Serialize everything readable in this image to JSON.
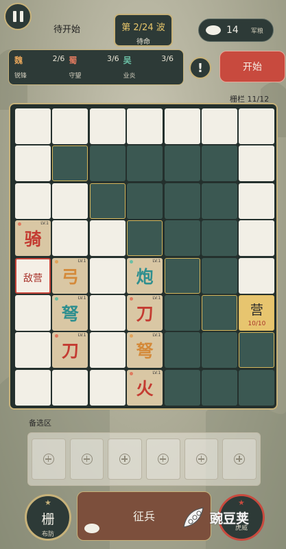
{
  "header": {
    "status": "待开始",
    "wave": {
      "title": "第 2/24 波",
      "subtitle": "待命"
    },
    "grain": {
      "count": "14",
      "label": "军粮"
    }
  },
  "factions": [
    {
      "name": "魏",
      "count": "2/6",
      "trait": "锐锋",
      "color": "#e2a35a"
    },
    {
      "name": "蜀",
      "count": "3/6",
      "trait": "守望",
      "color": "#e07a5f"
    },
    {
      "name": "吴",
      "count": "3/6",
      "trait": "业炎",
      "color": "#6bbfa5"
    }
  ],
  "alert_icon": "!",
  "start_label": "开始",
  "fence_count": "栅栏 11/12",
  "board": {
    "enemy_label": "敌营",
    "camp": {
      "char": "营",
      "hp": "10/10"
    },
    "units": [
      {
        "char": "骑",
        "lv": "LV.1",
        "color": "#c43c32"
      },
      {
        "char": "弓",
        "lv": "LV.1",
        "color": "#d48a3a"
      },
      {
        "char": "炮",
        "lv": "LV.1",
        "color": "#2f8f8f"
      },
      {
        "char": "弩",
        "lv": "LV.1",
        "color": "#2f8f8f"
      },
      {
        "char": "刀",
        "lv": "LV.1",
        "color": "#c43c32"
      },
      {
        "char": "刀",
        "lv": "LV.1",
        "color": "#c43c32"
      },
      {
        "char": "弩",
        "lv": "LV.1",
        "color": "#d48a3a"
      },
      {
        "char": "火",
        "lv": "LV.1",
        "color": "#c43c32"
      }
    ]
  },
  "bench": {
    "label": "备选区",
    "slots": 6
  },
  "bottom": {
    "fence_char": "栅",
    "fence_sub": "布防",
    "recruit_label": "征兵",
    "tiger_sub": "虎威"
  },
  "watermark": "豌豆荚"
}
